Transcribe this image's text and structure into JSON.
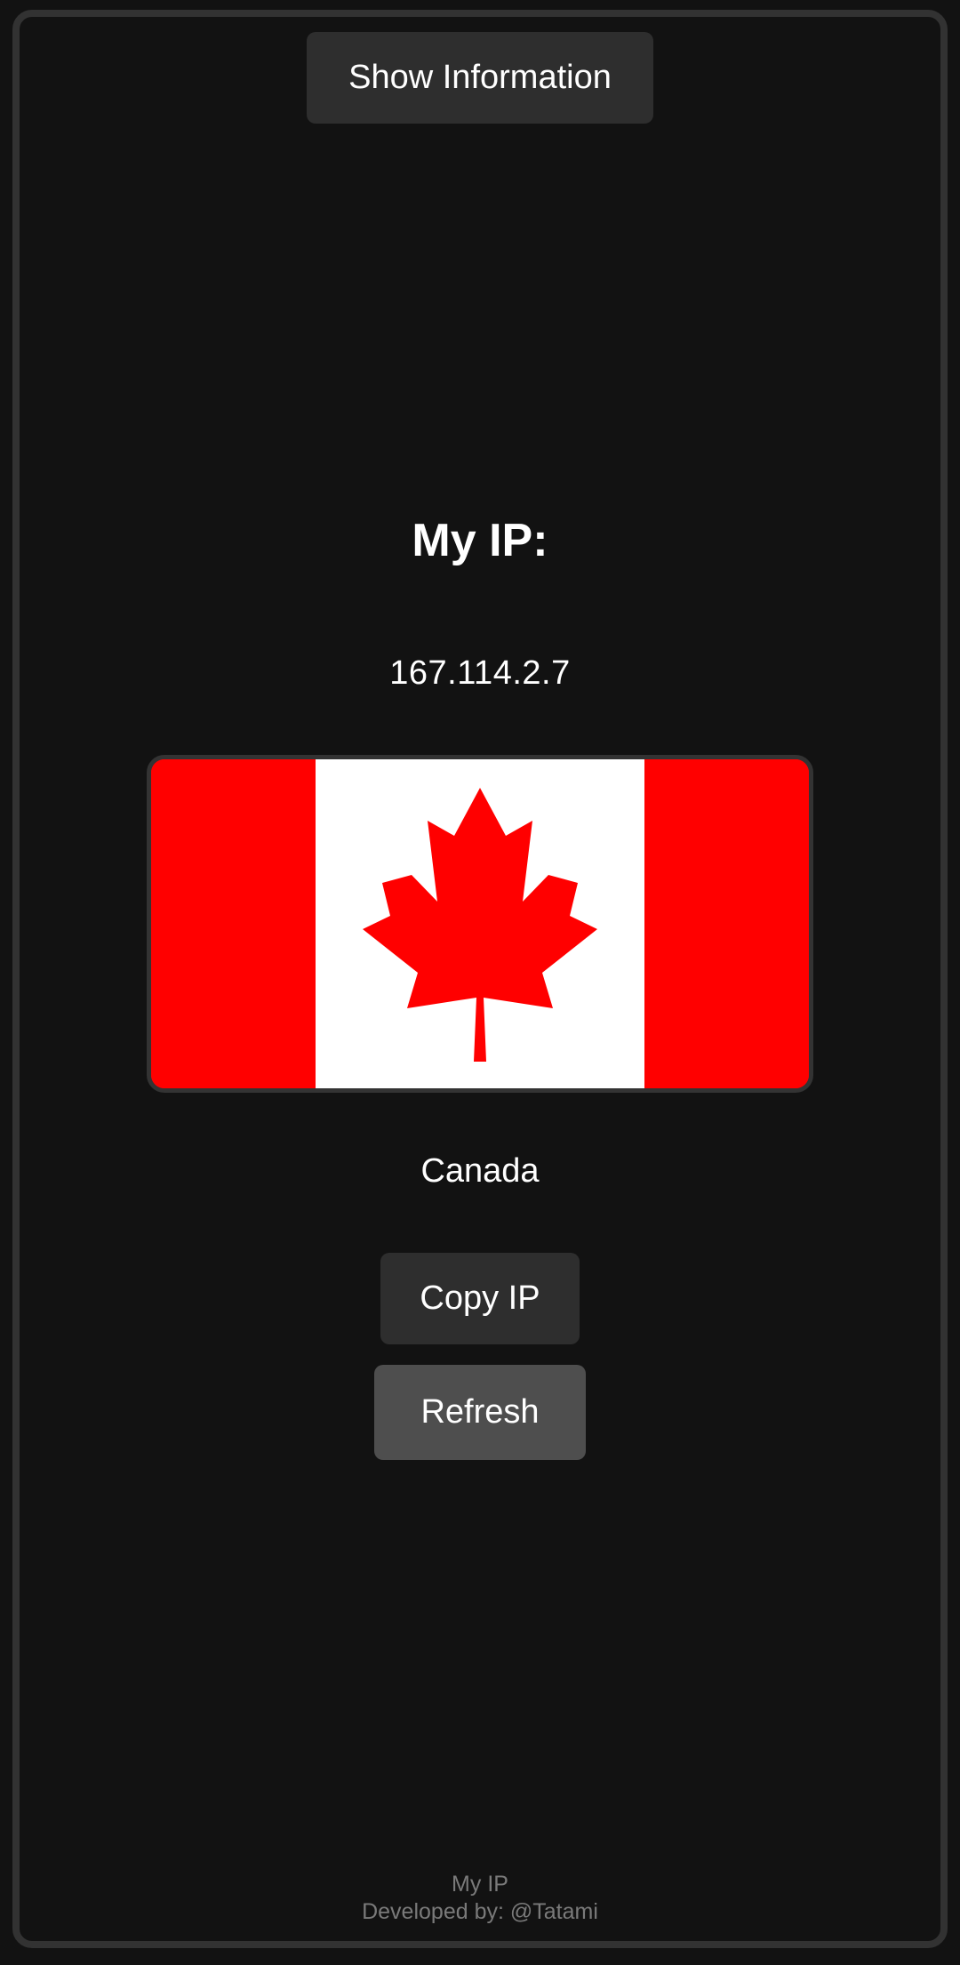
{
  "header": {
    "show_info_label": "Show Information"
  },
  "main": {
    "title": "My IP:",
    "ip_address": "167.114.2.7",
    "flag_icon": "canada-flag-icon",
    "country": "Canada",
    "copy_label": "Copy IP",
    "refresh_label": "Refresh"
  },
  "footer": {
    "app_name": "My IP",
    "credit": "Developed by: @Tatami"
  },
  "colors": {
    "background": "#121212",
    "frame_border": "#323232",
    "button": "#2e2e2e",
    "button_active": "#4e4e4e",
    "flag_red": "#ff0000",
    "flag_white": "#ffffff",
    "text": "#ffffff",
    "footer_text": "#7a7a7a"
  }
}
